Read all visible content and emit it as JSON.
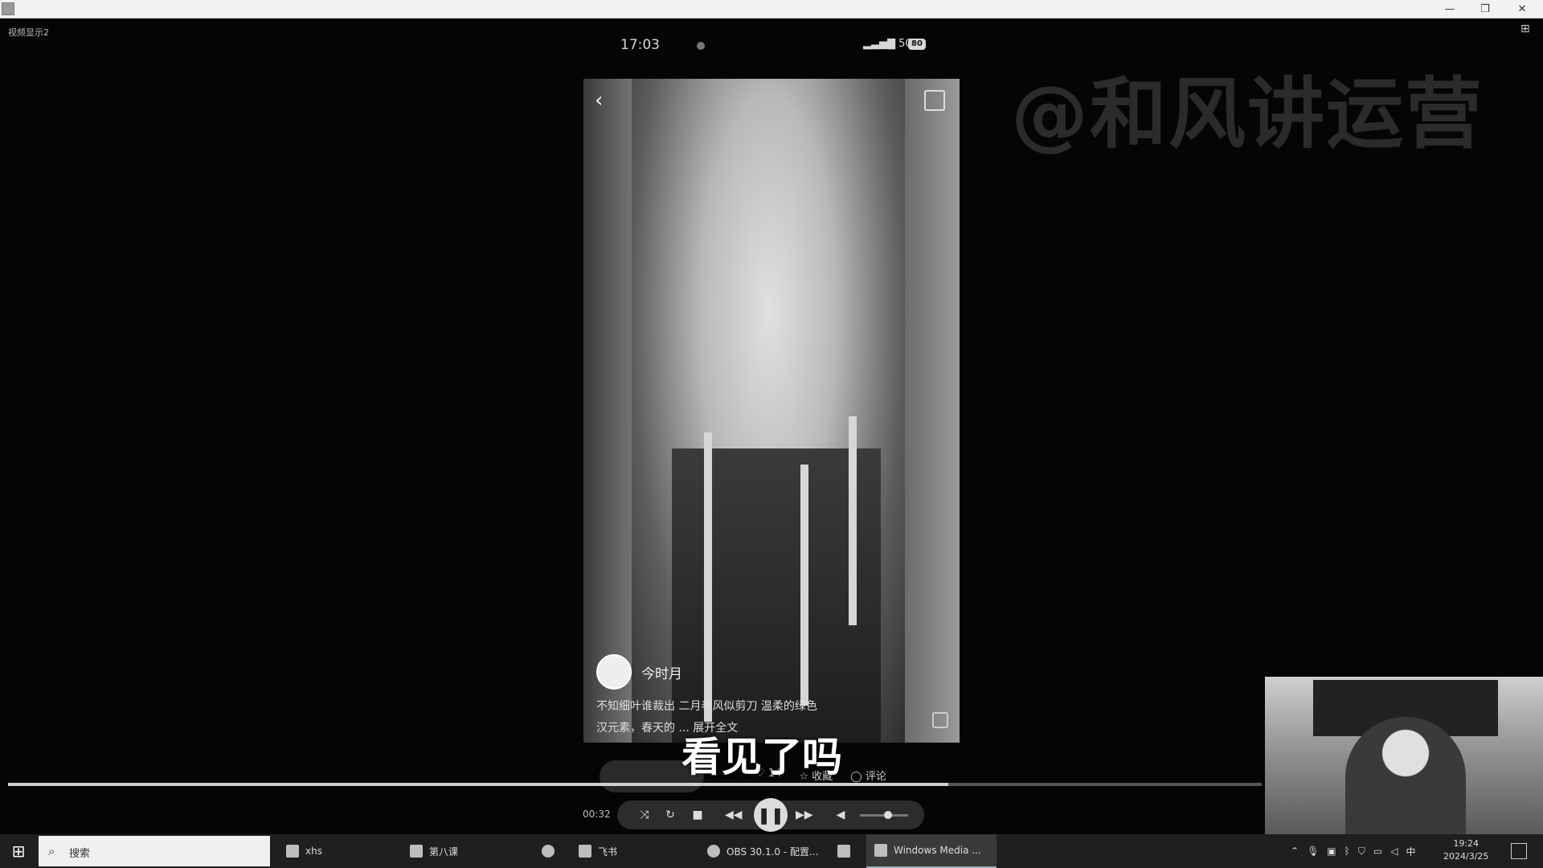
{
  "window": {
    "player_label": "视频显示2",
    "min": "—",
    "max": "❐",
    "close": "✕"
  },
  "phone_status": {
    "time": "17:03",
    "signal": "5G",
    "battery": "80"
  },
  "post": {
    "author": "今时月",
    "desc_line1": "不知细叶谁裁出 二月春风似剪刀 温柔的绿色",
    "desc_line2": "汉元素，春天的 ... 展开全文",
    "likes": "14",
    "collect_label": "收藏",
    "comment_label": "评论"
  },
  "watermark": "@和风讲运营",
  "subtitle": "看见了吗",
  "player": {
    "elapsed": "00:32",
    "progress_percent": 75
  },
  "taskbar": {
    "search_placeholder": "搜索",
    "tasks": [
      {
        "label": "xhs"
      },
      {
        "label": "第八课"
      },
      {
        "label": "飞书"
      },
      {
        "label": "OBS 30.1.0 - 配置..."
      },
      {
        "label": "Windows Media ..."
      }
    ],
    "ime": "中",
    "time": "19:24",
    "date": "2024/3/25"
  },
  "icons": {
    "back": "back-chevron-icon",
    "share": "share-icon",
    "play_pause": "pause-icon"
  }
}
